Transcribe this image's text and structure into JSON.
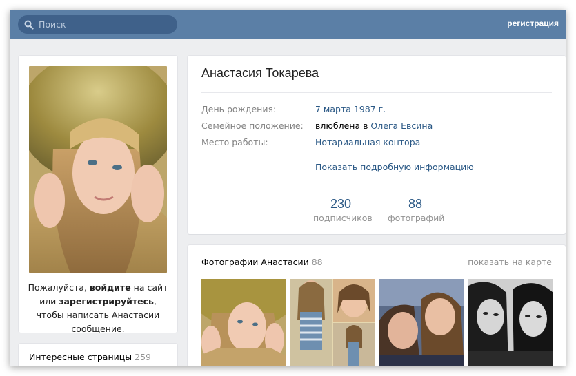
{
  "header": {
    "search_placeholder": "Поиск",
    "register_link": "регистрация"
  },
  "left": {
    "login_message": {
      "part1": "Пожалуйста, ",
      "login_link": "войдите",
      "part2": " на сайт или ",
      "register_link": "зарегистрируйтесь",
      "part3": ", чтобы написать Анастасии сообщение."
    },
    "interesting_pages": {
      "title": "Интересные страницы",
      "count": "259"
    }
  },
  "profile": {
    "name": "Анастасия Токарева",
    "rows": [
      {
        "label": "День рождения:",
        "value": "7 марта 1987 г."
      },
      {
        "label": "Семейное положение:",
        "value_prefix": "влюблена в ",
        "value": "Олега Евсина"
      },
      {
        "label": "Место работы:",
        "value": "Нотариальная контора"
      }
    ],
    "more_info_link": "Показать подробную информацию",
    "counters": [
      {
        "value": "230",
        "label": "подписчиков"
      },
      {
        "value": "88",
        "label": "фотографий"
      }
    ]
  },
  "photos": {
    "title": "Фотографии Анастасии",
    "count": "88",
    "map_link": "показать на карте"
  },
  "colors": {
    "header": "#5b7fa6",
    "search": "#3f618a",
    "link": "#2a5885",
    "muted": "#828282",
    "page_bg": "#edeef0"
  }
}
